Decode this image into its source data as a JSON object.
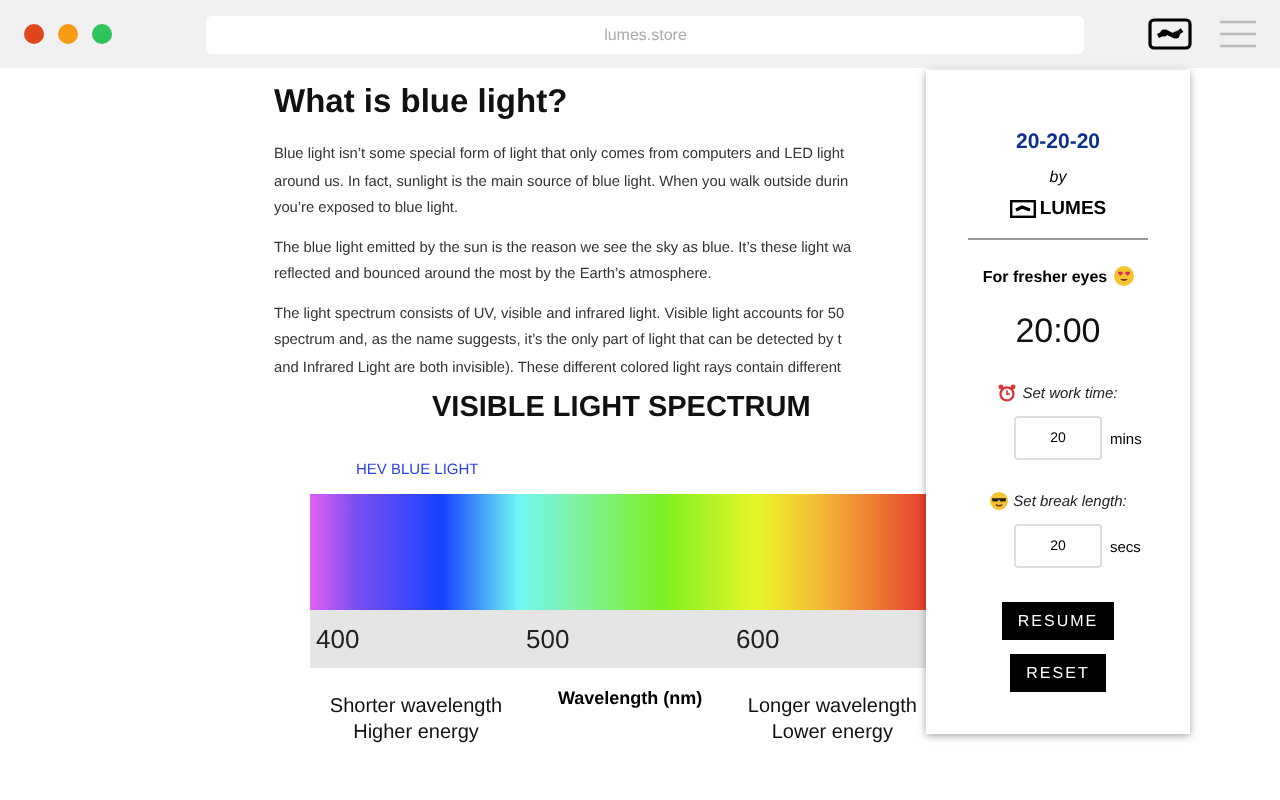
{
  "browser": {
    "url": "lumes.store"
  },
  "article": {
    "heading": "What is blue light?",
    "paragraphs": [
      [
        "Blue light isn’t some special form of light that only comes from computers and LED light",
        "around us. In fact, sunlight is the main source of blue light. When you walk outside durin",
        "you’re exposed to blue light."
      ],
      [
        "The blue light emitted by the sun is the reason we see the sky as blue. It’s these light wa",
        "reflected and bounced around the most by the Earth’s atmosphere."
      ],
      [
        "The light spectrum consists of UV, visible and infrared light. Visible light accounts for 50",
        "spectrum and, as the name suggests, it’s the only part of light that can be detected by t",
        "and Infrared Light are both invisible). These different colored light rays contain different"
      ]
    ]
  },
  "spectrum": {
    "title": "VISIBLE LIGHT SPECTRUM",
    "band_label": "HEV BLUE LIGHT",
    "ticks": [
      "400",
      "500",
      "600"
    ],
    "axis_title": "Wavelength (nm)",
    "left_note": [
      "Shorter wavelength",
      "Higher energy"
    ],
    "right_note": [
      "Longer wavelength",
      "Lower energy"
    ]
  },
  "popup": {
    "title": "20-20-20",
    "by": "by",
    "brand": "LUMES",
    "tagline": "For fresher eyes",
    "timer": "20:00",
    "settings": [
      {
        "kind": "alarm",
        "label": "Set work time:",
        "value": "20",
        "unit": "mins"
      },
      {
        "kind": "sunglasses",
        "label": "Set break length:",
        "value": "20",
        "unit": "secs"
      }
    ],
    "buttons": [
      "RESUME",
      "RESET"
    ]
  }
}
